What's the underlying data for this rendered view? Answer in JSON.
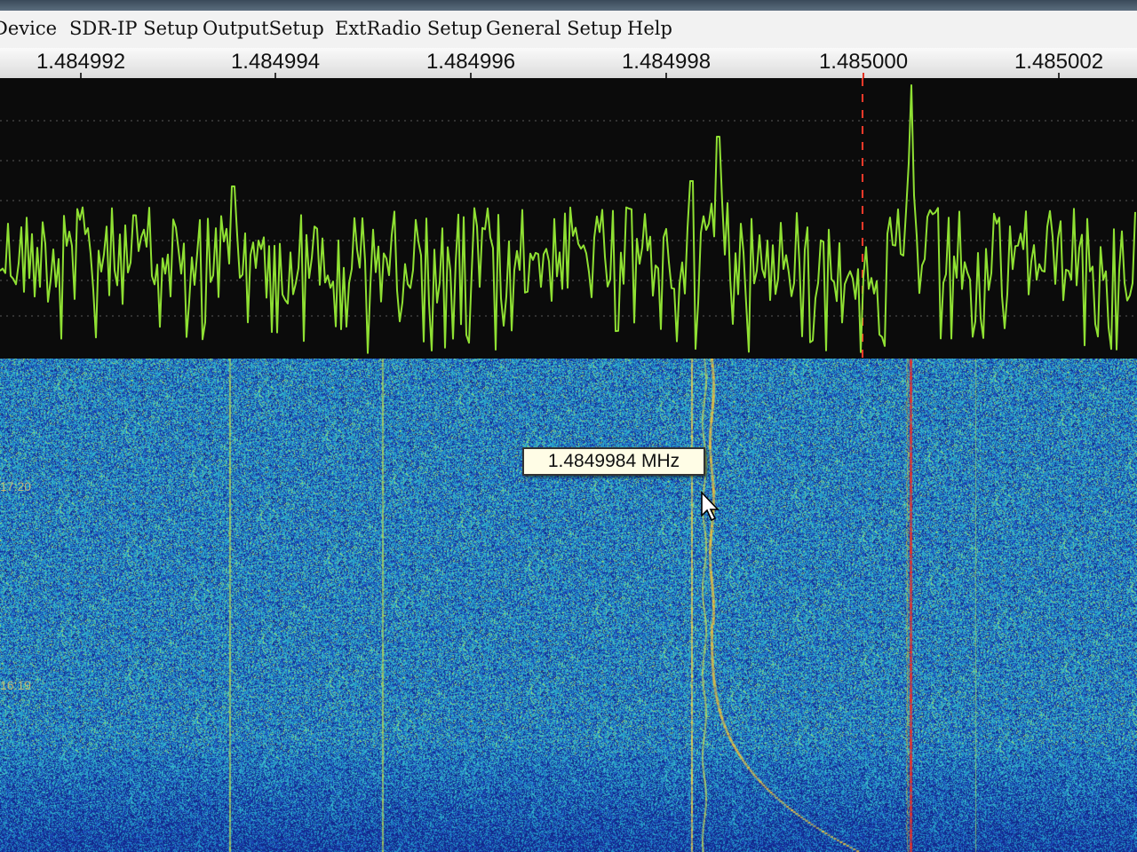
{
  "menu": {
    "items": [
      {
        "label": "Device"
      },
      {
        "label": "SDR-IP Setup"
      },
      {
        "label": "OutputSetup"
      },
      {
        "label": "ExtRadio Setup"
      },
      {
        "label": "General Setup"
      },
      {
        "label": "Help"
      }
    ]
  },
  "frequency_scale": {
    "ticks": [
      "1.484992",
      "1.484994",
      "1.484996",
      "1.484998",
      "1.485000",
      "1.485002"
    ]
  },
  "tooltip": {
    "text": "1.4849984 MHz"
  },
  "waterfall": {
    "time_labels": [
      "17:20",
      "16:19"
    ]
  },
  "colors": {
    "trace": "#8fe033",
    "marker": "#ff3a2a",
    "background": "#0b0b0b",
    "waterfall_base": "#1f8fb0"
  },
  "icons": {
    "pointer": "mouse-pointer-icon"
  }
}
